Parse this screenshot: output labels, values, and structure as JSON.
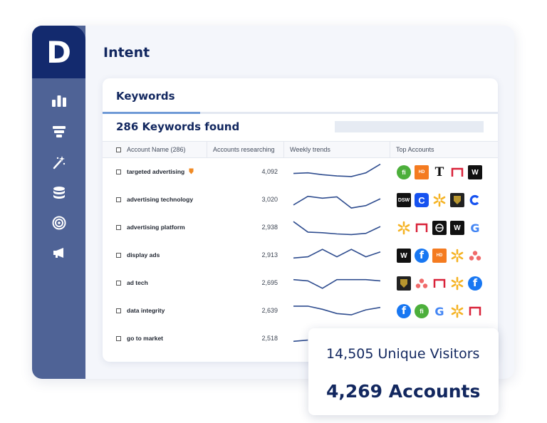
{
  "app": {
    "logo_letter": "D",
    "page_title": "Intent"
  },
  "sidebar": {
    "icons": [
      "bar-chart-icon",
      "funnel-icon",
      "magic-wand-icon",
      "database-icon",
      "target-icon",
      "megaphone-icon"
    ]
  },
  "card": {
    "tab_label": "Keywords",
    "found_text": "286 Keywords found"
  },
  "table": {
    "columns": [
      "Account Name (286)",
      "Accounts researching",
      "Weekly trends",
      "Top Accounts"
    ],
    "rows": [
      {
        "keyword": "targeted advertising",
        "count": "4,092",
        "flagged": true,
        "trend": [
          40,
          41,
          38,
          36,
          35,
          41,
          55
        ],
        "logos": [
          "hellofresh",
          "home-depot",
          "nyt",
          "square-outline",
          "wwe"
        ]
      },
      {
        "keyword": "advertising technology",
        "count": "3,020",
        "flagged": false,
        "trend": [
          34,
          48,
          45,
          47,
          29,
          33,
          44
        ],
        "logos": [
          "dsw",
          "coinbase-square",
          "walmart",
          "lamborghini",
          "coinbase"
        ]
      },
      {
        "keyword": "advertising platform",
        "count": "2,938",
        "flagged": false,
        "trend": [
          52,
          35,
          34,
          32,
          31,
          33,
          44
        ],
        "logos": [
          "walmart",
          "square-outline",
          "shield-outline",
          "wwe",
          "google"
        ]
      },
      {
        "keyword": "display ads",
        "count": "2,913",
        "flagged": false,
        "trend": [
          38,
          40,
          52,
          40,
          52,
          40,
          48
        ],
        "logos": [
          "wwe",
          "facebook",
          "home-depot",
          "walmart",
          "asana"
        ]
      },
      {
        "keyword": "ad tech",
        "count": "2,695",
        "flagged": false,
        "trend": [
          48,
          46,
          34,
          48,
          48,
          48,
          46
        ],
        "logos": [
          "lamborghini",
          "asana",
          "square-outline",
          "walmart",
          "facebook"
        ]
      },
      {
        "keyword": "data integrity",
        "count": "2,639",
        "flagged": false,
        "trend": [
          50,
          50,
          45,
          38,
          36,
          44,
          48
        ],
        "logos": [
          "facebook",
          "hellofresh",
          "google",
          "walmart",
          "square-outline"
        ]
      },
      {
        "keyword": "go to market",
        "count": "2,518",
        "flagged": false,
        "trend": [
          38,
          40
        ],
        "logos": []
      }
    ]
  },
  "stats": {
    "visitors": "14,505 Unique Visitors",
    "accounts": "4,269 Accounts"
  },
  "colors": {
    "navy": "#132a6e",
    "sidebar": "#4f6396",
    "accent": "#6f9ad6",
    "spark": "#2f4d8f"
  }
}
